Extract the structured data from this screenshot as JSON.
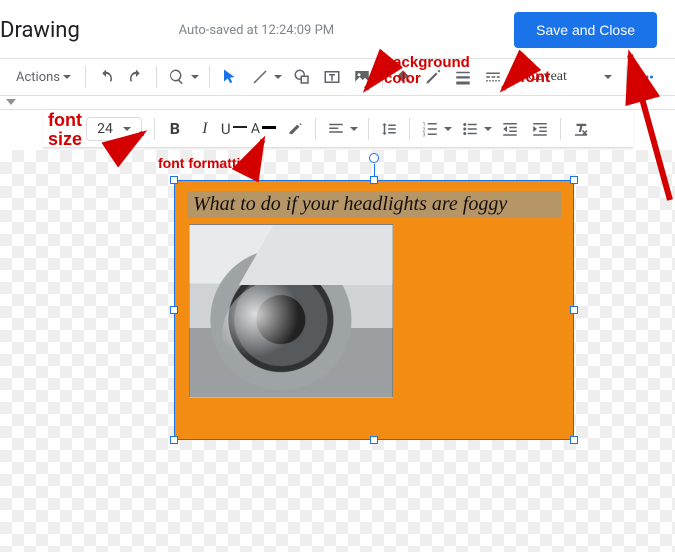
{
  "header": {
    "title": "Drawing",
    "autosave": "Auto-saved at 12:24:09 PM",
    "save_close": "Save and Close"
  },
  "toolbar": {
    "actions": "Actions",
    "font_name": "Caveat",
    "font_size": "24"
  },
  "annotations": {
    "font_size": "font\nsize",
    "background_color": "background\ncolor",
    "font": "font",
    "font_formatting": "font formatting"
  },
  "canvas": {
    "textbox_text": "What to do if your headlights are foggy"
  }
}
